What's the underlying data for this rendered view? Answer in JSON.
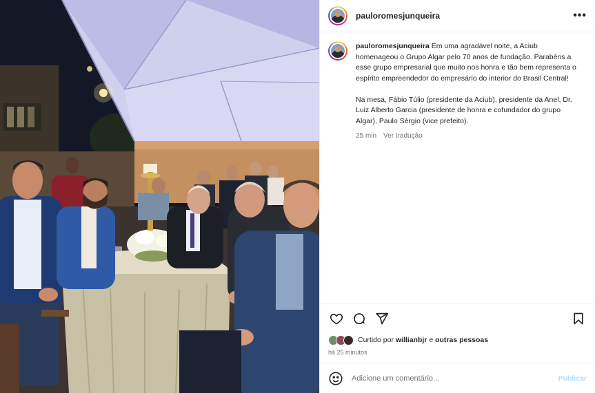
{
  "post": {
    "username": "pauloromesjunqueira",
    "more_label": "•••"
  },
  "caption": {
    "username": "pauloromesjunqueira",
    "text": "Em uma agradável noite, a Aciub homenageou o Grupo Algar pelo 70 anos de fundação. Parabéns a esse grupo empresarial que muito nos honra e tão bem representa o espírito empreendedor do empresário do interior do Brasil Central!\n\nNa mesa, Fábio Túlio (presidente da Aciub), presidente da Anel, Dr. Luiz Alberto Garcia (presidente de honra e cofundador do grupo Algar), Paulo Sérgio (vice prefeito).",
    "time": "25 min",
    "translate": "Ver tradução"
  },
  "actions": {
    "like_icon": "heart-icon",
    "comment_icon": "comment-icon",
    "share_icon": "share-icon",
    "save_icon": "bookmark-icon"
  },
  "likes": {
    "prefix": "Curtido por",
    "user": "willianbjr",
    "conjunction": "e",
    "others": "outras pessoas",
    "avatar_colors": [
      "#6b8e6b",
      "#8a4a5a",
      "#3a2a2a"
    ]
  },
  "posted_ago": "há 25 minutos",
  "comment_box": {
    "placeholder": "Adicione um comentário...",
    "publish_label": "Publicar"
  },
  "colors": {
    "publish_disabled": "#b3dbff",
    "secondary_text": "#737373",
    "divider": "#efefef"
  }
}
